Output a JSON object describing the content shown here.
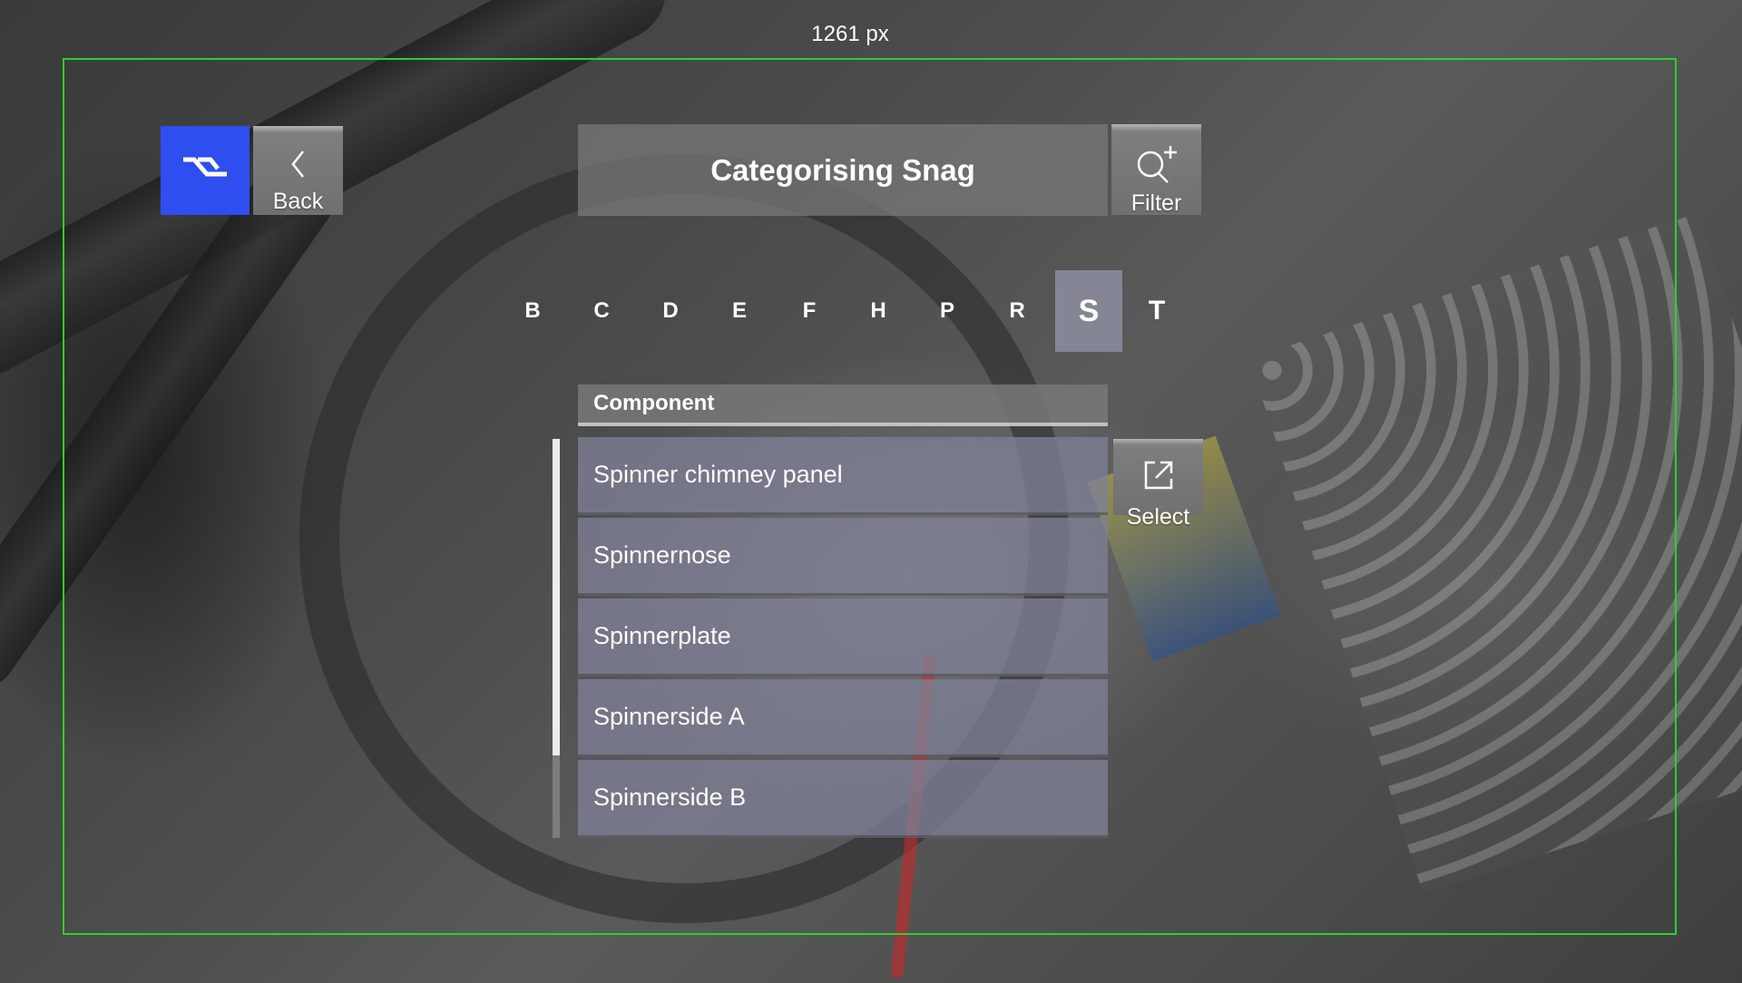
{
  "measurement": {
    "width_label": "1261 px"
  },
  "title": "Categorising Snag",
  "buttons": {
    "back_label": "Back",
    "filter_label": "Filter",
    "select_label": "Select"
  },
  "letters": [
    "B",
    "C",
    "D",
    "E",
    "F",
    "H",
    "P",
    "R",
    "S",
    "T"
  ],
  "active_letter": "S",
  "list": {
    "header": "Component",
    "items": [
      "Spinner chimney panel",
      "Spinnernose",
      "Spinnerplate",
      "Spinnerside A",
      "Spinnerside B"
    ]
  },
  "icons": {
    "home": "home-logo-icon",
    "back": "chevron-left-icon",
    "filter": "search-plus-icon",
    "select": "open-external-icon"
  },
  "colors": {
    "accent": "#2f4ef0",
    "frame": "#2bd12b",
    "active_letter_bg": "#8c8ea0"
  }
}
